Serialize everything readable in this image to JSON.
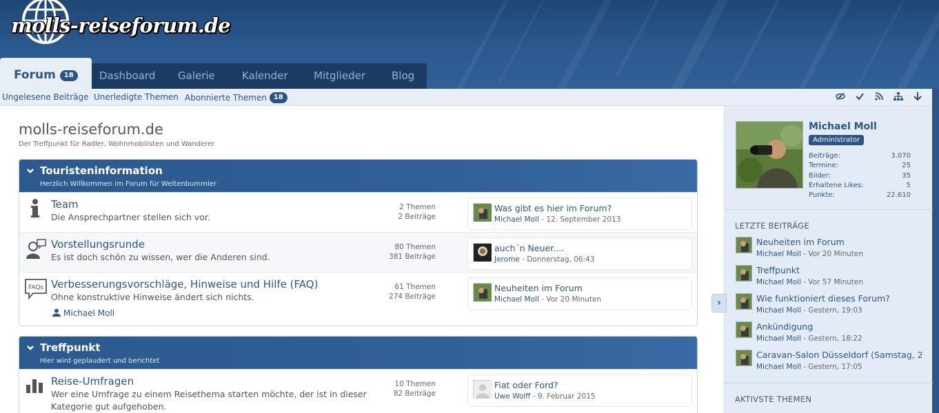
{
  "logo": {
    "text": "molls-reiseforum.de"
  },
  "nav": {
    "tabs": [
      {
        "label": "Forum",
        "badge": "18"
      },
      {
        "label": "Dashboard"
      },
      {
        "label": "Galerie"
      },
      {
        "label": "Kalender"
      },
      {
        "label": "Mitglieder"
      },
      {
        "label": "Blog"
      }
    ]
  },
  "subnav": {
    "links": [
      {
        "label": "Ungelesene Beiträge"
      },
      {
        "label": "Unerledigte Themen"
      },
      {
        "label": "Abonnierte Themen",
        "badge": "18"
      }
    ]
  },
  "page": {
    "title": "molls-reiseforum.de",
    "description": "Der Treffpunkt für Radler, Wohnmobilisten und Wanderer"
  },
  "categories": [
    {
      "title": "Touristeninformation",
      "subtitle": "Herzlich Willkommen im Forum für Weltenbummler",
      "boards": [
        {
          "title": "Team",
          "description": "Die Ansprechpartner stellen sich vor.",
          "threads": "2 Themen",
          "posts": "2 Beiträge",
          "last_title": "Was gibt es hier im Forum?",
          "last_user": "Michael Moll",
          "last_time": " - 12. September 2013"
        },
        {
          "title": "Vorstellungsrunde",
          "description": "Es ist doch schön zu wissen, wer die Anderen sind.",
          "threads": "80 Themen",
          "posts": "381 Beiträge",
          "last_title": "auch´n Neuer....",
          "last_user": "Jerome",
          "last_time": " - Donnerstag, 06:43"
        },
        {
          "title": "Verbesserungsvorschläge, Hinweise und Hilfe (FAQ)",
          "description": "Ohne konstruktive Hinweise ändert sich nichts.",
          "moderator": "Michael Moll",
          "threads": "61 Themen",
          "posts": "274 Beiträge",
          "last_title": "Neuheiten im Forum",
          "last_user": "Michael Moll",
          "last_time": " - Vor 20 Minuten"
        }
      ]
    },
    {
      "title": "Treffpunkt",
      "subtitle": "Hier wird geplaudert und berichtet",
      "boards": [
        {
          "title": "Reise-Umfragen",
          "description": "Wer eine Umfrage zu einem Reisethema starten möchte, der ist in dieser",
          "description2": "Kategorie gut aufgehoben.",
          "threads": "10 Themen",
          "posts": "82 Beiträge",
          "last_title": "Fiat oder Ford?",
          "last_user": "Uwe Wolff",
          "last_time": " - 9. Februar 2015"
        }
      ]
    }
  ],
  "sidebar": {
    "user": {
      "name": "Michael Moll",
      "role": "Administrator",
      "stats": [
        {
          "label": "Beiträge:",
          "value": "3.070"
        },
        {
          "label": "Termine:",
          "value": "25"
        },
        {
          "label": "Bilder:",
          "value": "35"
        },
        {
          "label": "Erhaltene Likes:",
          "value": "5"
        },
        {
          "label": "Punkte:",
          "value": "22.610"
        }
      ]
    },
    "recent_heading": "LETZTE BEITRÄGE",
    "recent": [
      {
        "title": "Neuheiten im Forum",
        "user": "Michael Moll",
        "time": " - Vor 20 Minuten"
      },
      {
        "title": "Treffpunkt",
        "user": "Michael Moll",
        "time": " - Vor 57 Minuten"
      },
      {
        "title": "Wie funktioniert dieses Forum?",
        "user": "Michael Moll",
        "time": " - Gestern, 19:03"
      },
      {
        "title": "Ankündigung",
        "user": "Michael Moll",
        "time": " - Gestern, 18:22"
      },
      {
        "title": "Caravan-Salon Düsseldorf (Samstag, 2...",
        "user": "Michael Moll",
        "time": " - Gestern, 17:05"
      }
    ],
    "active_heading": "AKTIVSTE THEMEN"
  },
  "colors": {
    "brand": "#2c5486",
    "header_bg": "#1f4675",
    "category_bar": "#305f96"
  }
}
